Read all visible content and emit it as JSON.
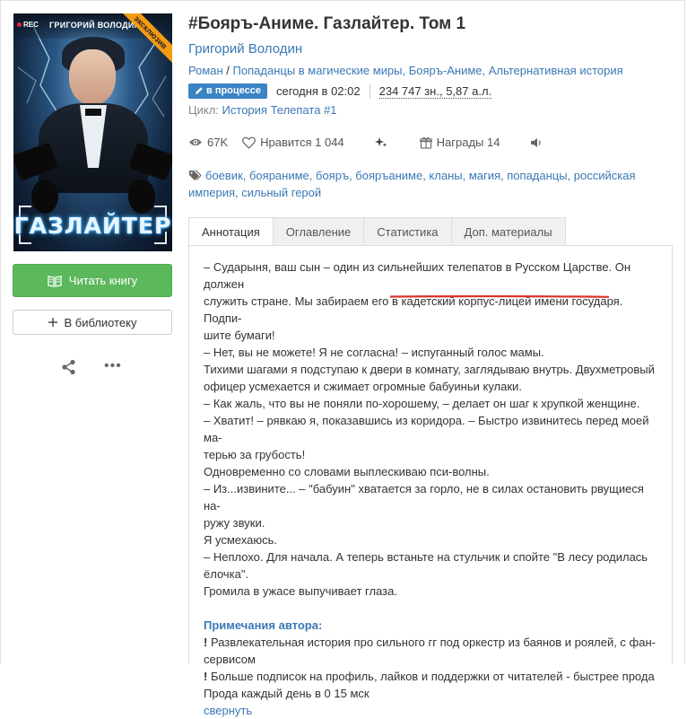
{
  "cover": {
    "rec": "REC",
    "author": "ГРИГОРИЙ ВОЛОДИН",
    "exclusive": "эксклюзив",
    "title": "ГАЗЛАЙТЕР"
  },
  "actions": {
    "read_label": "Читать книгу",
    "library_label": "В библиотеку",
    "share_icon": "share-icon",
    "more_icon": "more-icon"
  },
  "book": {
    "title": "#Бояръ-Аниме. Газлайтер. Том 1",
    "author": "Григорий Володин",
    "genres": [
      "Роман",
      "Попаданцы в магические миры, Бояръ-Аниме, Альтернативная история"
    ],
    "genre_sep": " / ",
    "status": "в процессе",
    "updated": "сегодня в 02:02",
    "size": "234 747 зн., 5,87 а.л.",
    "cycle_label": "Цикл:",
    "cycle_value": "История Телепата #1"
  },
  "stats": {
    "views": "67K",
    "likes": "Нравится 1 044",
    "awards": "Награды 14"
  },
  "tags": "боевик, бояраниме, бояръ, бояръаниме, кланы, магия, попаданцы, российская империя, сильный герой",
  "tabs": [
    "Аннотация",
    "Оглавление",
    "Статистика",
    "Доп. материалы"
  ],
  "annotation": {
    "lines": [
      "– Сударыня, ваш сын – один из сильнейших телепатов в Русском Царстве. Он должен",
      "служить стране. Мы забираем его в кадетский корпус-лицей имени государя. Подпи-",
      "шите бумаги!",
      "– Нет, вы не можете! Я не согласна! – испуганный голос мамы.",
      "Тихими шагами я подступаю к двери в комнату, заглядываю внутрь. Двухметровый",
      "офицер усмехается и сжимает огромные бабуиньи кулаки.",
      "– Как жаль, что вы не поняли по-хорошему, – делает он шаг к хрупкой женщине.",
      "– Хватит! – рявкаю я, показавшись из коридора. – Быстро извинитесь перед моей ма-",
      "терью за грубость!",
      "Одновременно со словами выплескиваю пси-волны.",
      "– Из...извините... – \"бабуин\" хватается за горло, не в силах остановить рвущиеся на-",
      "ружу звуки.",
      "Я усмехаюсь.",
      "– Неплохо. Для начала. А теперь встаньте на стульчик и спойте \"В лесу родилась",
      "ёлочка\".",
      "Громила в ужасе выпучивает глаза."
    ],
    "notes_title": "Примечания автора:",
    "note_marker": "!",
    "notes": [
      " Развлекательная история про сильного гг под оркестр из баянов и роялей, с фан-",
      "сервисом",
      " Больше подписок на профиль, лайков и поддержки от читателей - быстрее прода",
      "Прода каждый день в 0 15 мск"
    ],
    "collapse_label": "свернуть"
  },
  "colors": {
    "link": "#3a78b5",
    "read_button": "#5cb85c",
    "status_badge": "#3a84c4",
    "exclusive_ribbon": "#f59b12",
    "annotation_underline": "#d9342b"
  }
}
